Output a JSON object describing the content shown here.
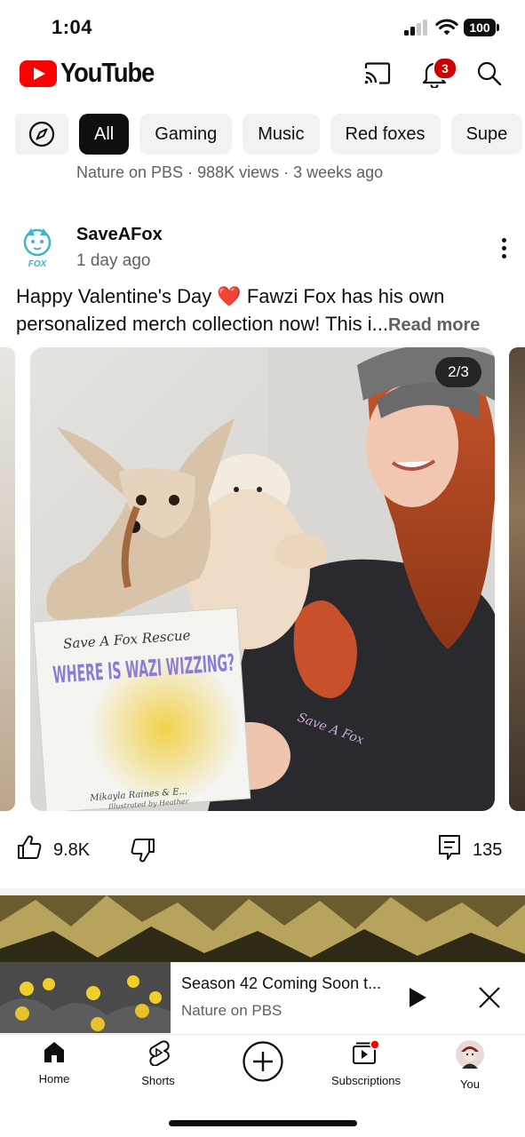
{
  "status_bar": {
    "time": "1:04",
    "battery": "100"
  },
  "header": {
    "logo_text": "YouTube",
    "notification_count": "3",
    "brand_color": "#ff0000"
  },
  "chips": [
    "All",
    "Gaming",
    "Music",
    "Red foxes",
    "Supe"
  ],
  "previous_video": {
    "meta": "Nature on PBS · 988K views · 3 weeks ago"
  },
  "post": {
    "channel": "SaveAFox",
    "age": "1 day ago",
    "text": "Happy Valentine's Day ❤️ Fawzi Fox has his own personalized merch collection now! This i...",
    "read_more": "Read more",
    "image_counter": "2/3",
    "book_title_top": "Save A Fox Rescue",
    "book_title_main": "WHERE IS WAZI WIZZING?",
    "book_author": "Mikayla Raines & E...",
    "book_illustrator": "Illustrated by Heather",
    "shirt_text": "Save A Fox",
    "likes": "9.8K",
    "comments": "135"
  },
  "mini_player": {
    "title": "Season 42 Coming Soon t...",
    "channel": "Nature on PBS"
  },
  "nav": {
    "home": "Home",
    "shorts": "Shorts",
    "subscriptions": "Subscriptions",
    "you": "You"
  }
}
